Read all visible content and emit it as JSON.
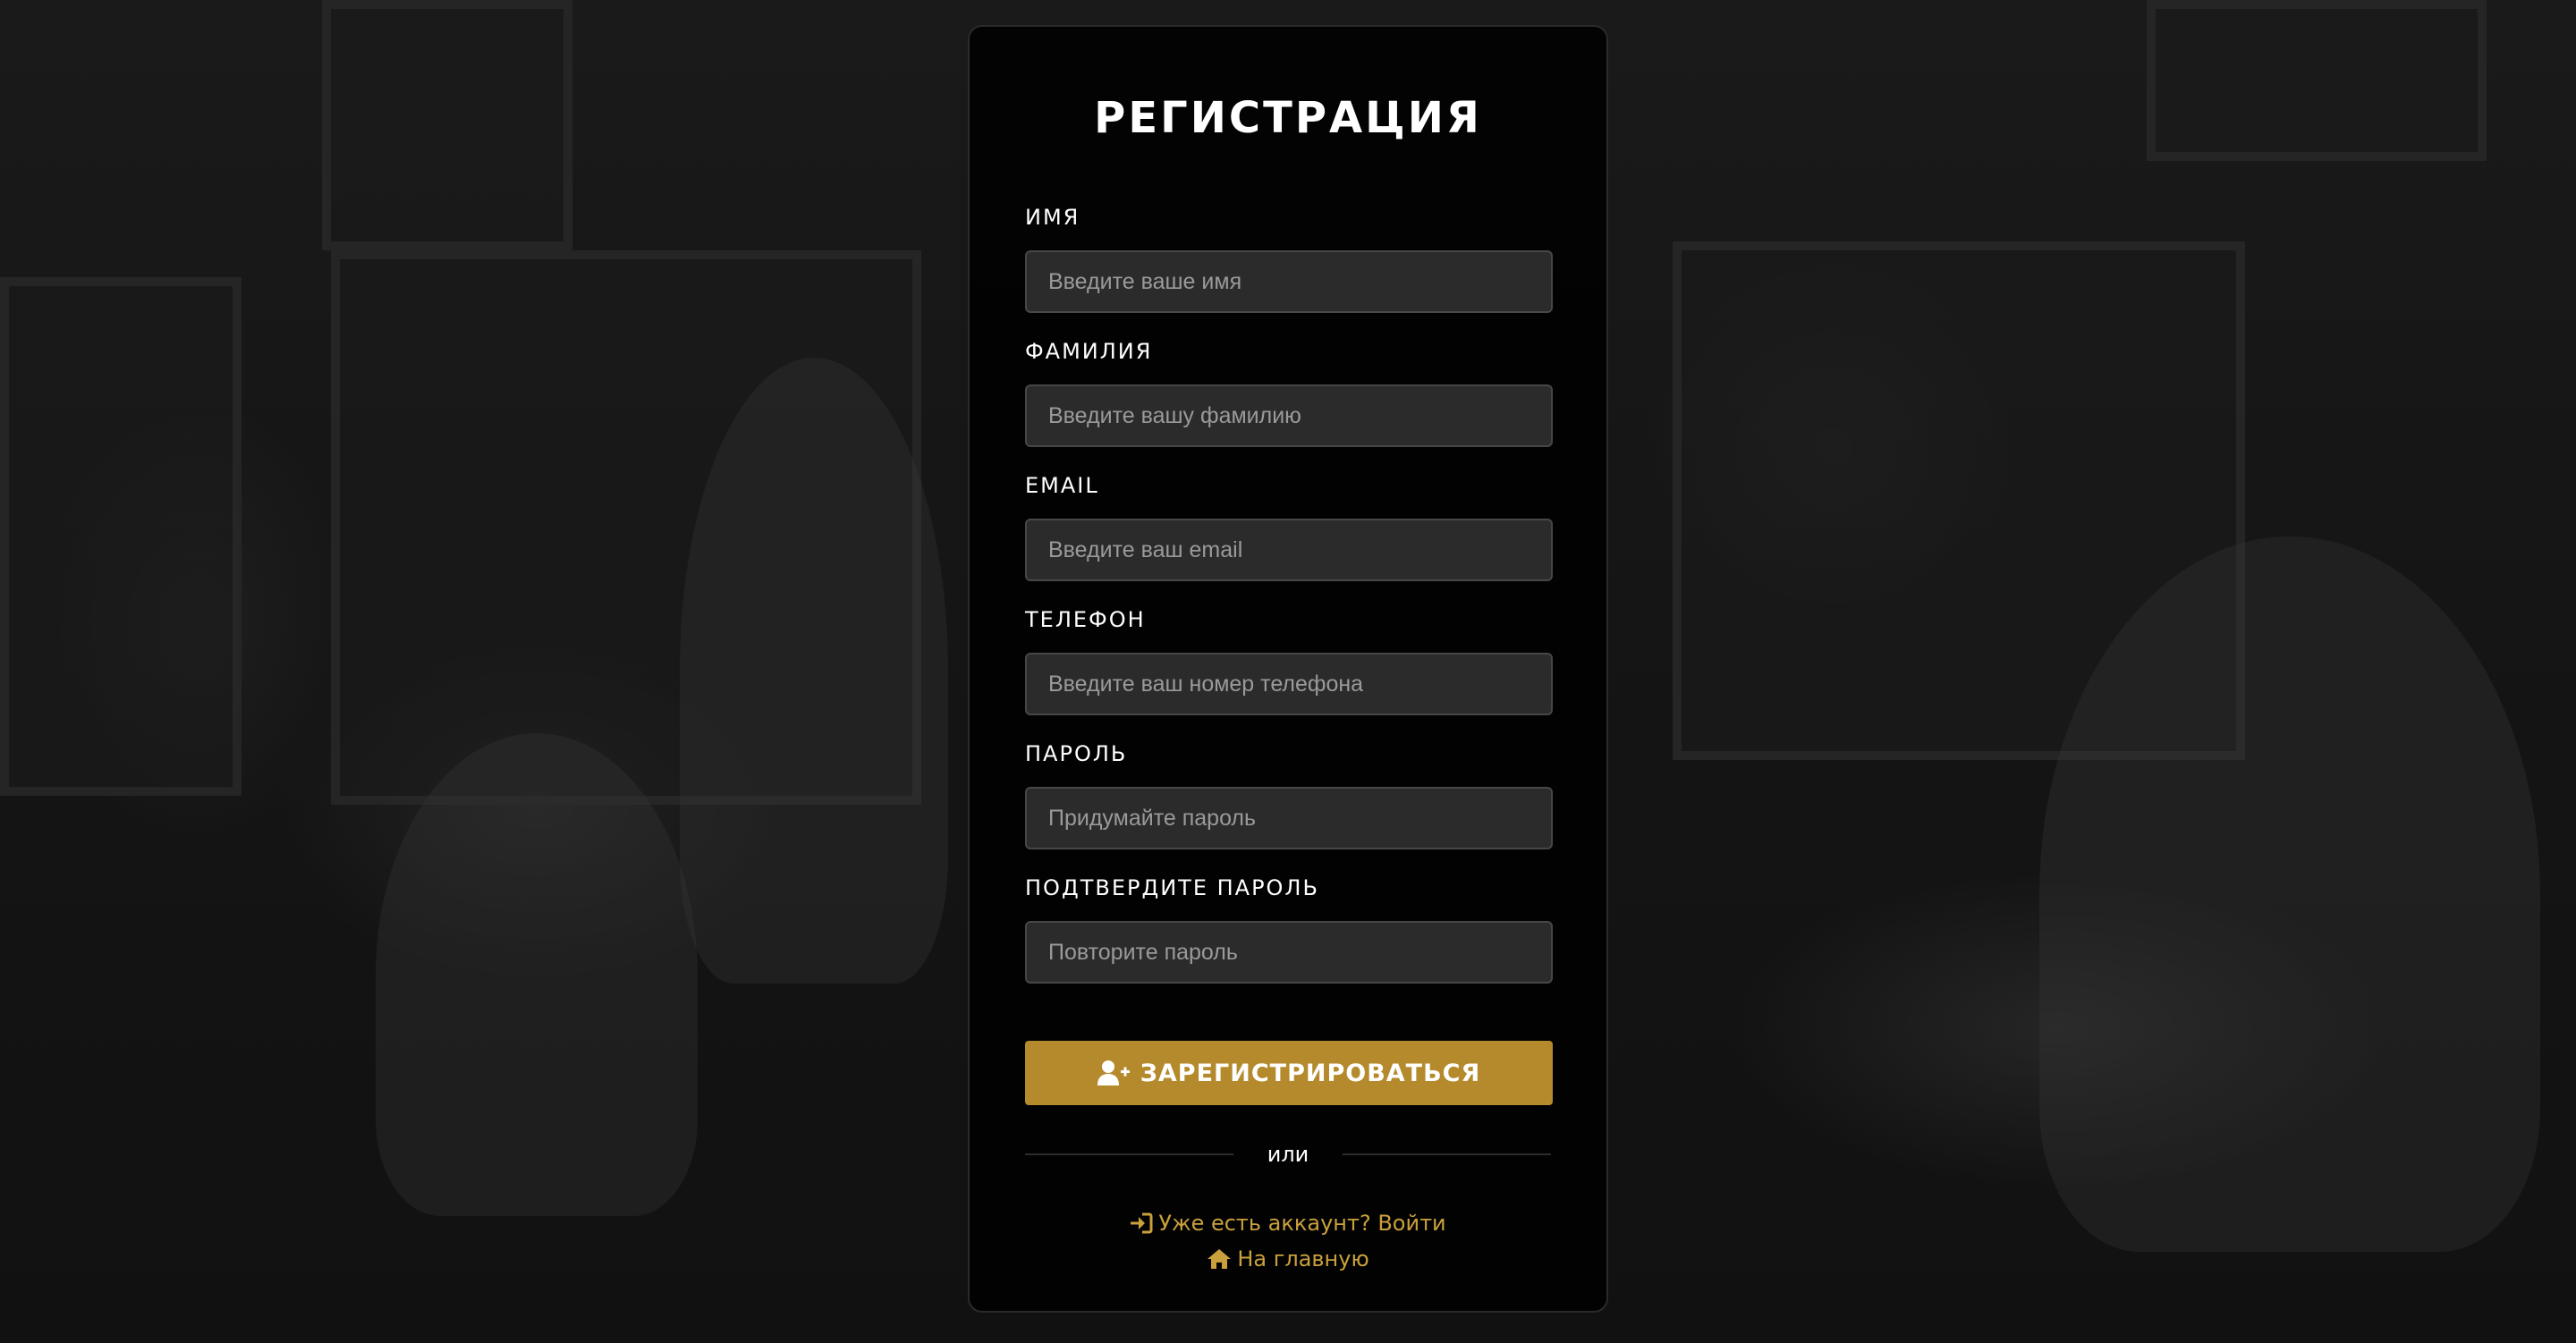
{
  "form": {
    "title": "РЕГИСТРАЦИЯ",
    "fields": [
      {
        "label": "ИМЯ",
        "placeholder": "Введите ваше имя",
        "value": ""
      },
      {
        "label": "ФАМИЛИЯ",
        "placeholder": "Введите вашу фамилию",
        "value": ""
      },
      {
        "label": "EMAIL",
        "placeholder": "Введите ваш email",
        "value": ""
      },
      {
        "label": "ТЕЛЕФОН",
        "placeholder": "Введите ваш номер телефона",
        "value": ""
      },
      {
        "label": "ПАРОЛЬ",
        "placeholder": "Придумайте пароль",
        "value": ""
      },
      {
        "label": "ПОДТВЕРДИТЕ ПАРОЛЬ",
        "placeholder": "Повторите пароль",
        "value": ""
      }
    ],
    "submit_label": "ЗАРЕГИСТРИРОВАТЬСЯ",
    "submit_icon": "user-plus-icon",
    "divider_text": "или",
    "login_link": {
      "label": "Уже есть аккаунт? Войти",
      "icon": "sign-in-icon"
    },
    "home_link": {
      "label": "На главную",
      "icon": "home-icon"
    }
  },
  "colors": {
    "accent": "#b48a2c",
    "link": "#c9a03c",
    "card_background": "#000000",
    "input_background": "#2b2b2b"
  }
}
